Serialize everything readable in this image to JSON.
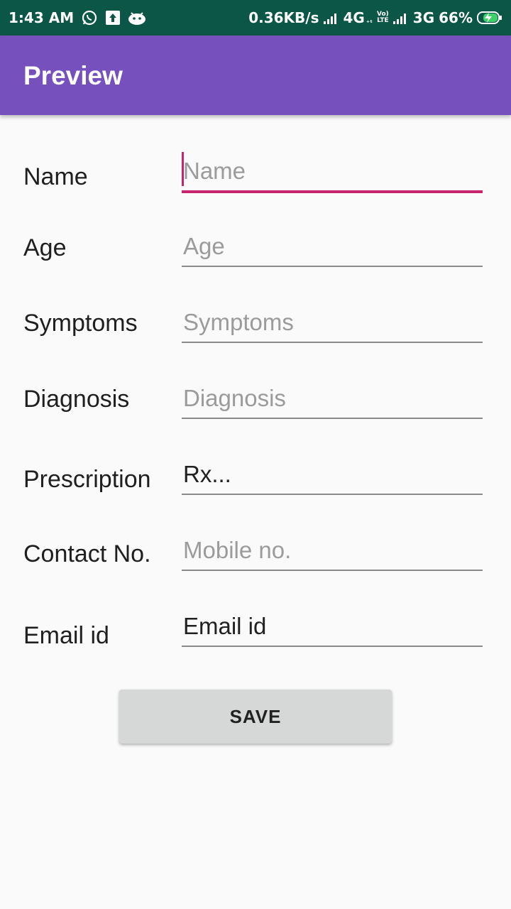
{
  "status_bar": {
    "time": "1:43 AM",
    "net_speed": "0.36KB/s",
    "net_4g": "4G",
    "net_4g_sub": "₊ₜ",
    "volte_top": "Vo)",
    "volte_bottom": "LTE",
    "net_3g": "3G",
    "battery": "66%",
    "icons": [
      "whatsapp-icon",
      "upload-icon",
      "android-icon",
      "signal-icon",
      "signal-icon",
      "battery-charging-icon"
    ]
  },
  "appbar": {
    "title": "Preview"
  },
  "form": {
    "fields": [
      {
        "label": "Name",
        "placeholder": "Name",
        "value": ""
      },
      {
        "label": "Age",
        "placeholder": "Age",
        "value": ""
      },
      {
        "label": "Symptoms",
        "placeholder": "Symptoms",
        "value": ""
      },
      {
        "label": "Diagnosis",
        "placeholder": "Diagnosis",
        "value": ""
      },
      {
        "label": "Prescription",
        "placeholder": "",
        "value": "Rx..."
      },
      {
        "label": "Contact No.",
        "placeholder": "Mobile no.",
        "value": ""
      },
      {
        "label": "Email id",
        "placeholder": "",
        "value": "Email id"
      }
    ],
    "save_label": "SAVE"
  },
  "colors": {
    "status_bar": "#0b5646",
    "app_bar": "#7650bc",
    "accent": "#c8246c",
    "button": "#d6d7d7"
  }
}
